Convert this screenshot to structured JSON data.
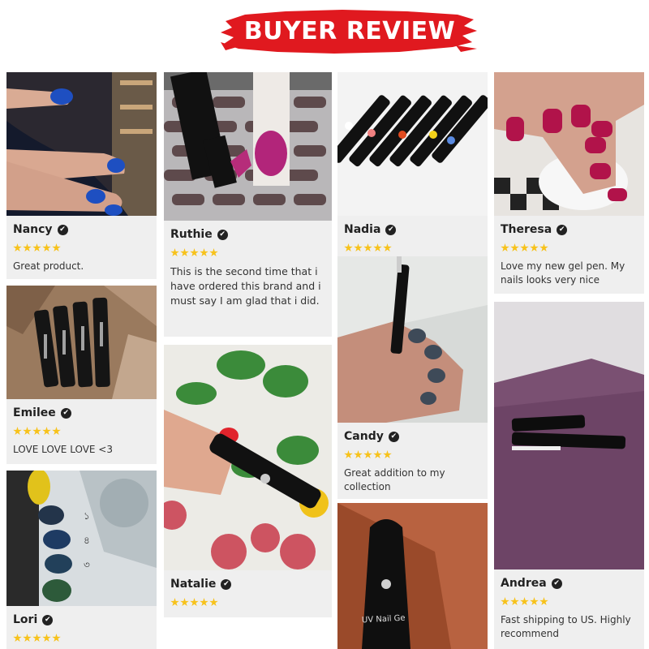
{
  "banner": {
    "title": "BUYER REVIEW"
  },
  "reviews": [
    {
      "name": "Nancy",
      "stars": 5,
      "text": "Great product."
    },
    {
      "name": "Emilee",
      "stars": 5,
      "text": "LOVE LOVE LOVE <3"
    },
    {
      "name": "Lori",
      "stars": 5,
      "text": ""
    },
    {
      "name": "Ruthie",
      "stars": 5,
      "text": "This is the second time that i have ordered this brand and i must say I am glad that i did."
    },
    {
      "name": "Natalie",
      "stars": 5,
      "text": ""
    },
    {
      "name": "Nadia",
      "stars": 5,
      "text": ""
    },
    {
      "name": "Candy",
      "stars": 5,
      "text": "Great addition to my collection"
    },
    {
      "name": "Theresa",
      "stars": 5,
      "text": "Love my new gel pen. My nails looks very nice"
    },
    {
      "name": "Andrea",
      "stars": 5,
      "text": "Fast shipping to US. Highly recommend"
    }
  ],
  "product_label": {
    "line1": "UV Nail Ge"
  },
  "colors": {
    "banner_red": "#e0191f",
    "star": "#f7c21b",
    "card_bg": "#efefef"
  },
  "icons": {
    "verified": "check-circle-icon",
    "rating": "star-icon"
  }
}
